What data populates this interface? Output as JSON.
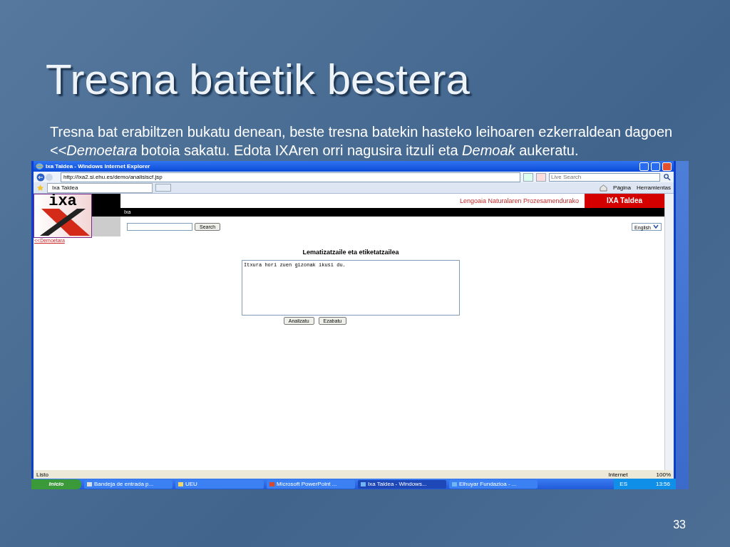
{
  "slide": {
    "title": "Tresna batetik bestera",
    "body": "Tresna bat erabiltzen bukatu denean, beste tresna batekin hasteko leihoaren ezkerraldean dagoen <<*Demoetara* botoia sakatu. Edota IXAren orri nagusira itzuli eta *Demoak* aukeratu.",
    "page_number": "33"
  },
  "browser": {
    "title": "Ixa Taldea - Windows Internet Explorer",
    "address": "http://ixa2.si.ehu.es/demo/analisiscf.jsp",
    "search_placeholder": "Live Search",
    "tab": "Ixa Taldea",
    "toolbar": [
      "Página",
      "Herramientas"
    ],
    "status": "Listo",
    "zone": "Internet",
    "zoom": "100%"
  },
  "page": {
    "logo": "ixa",
    "header": "Lengoaia Naturalaren Prozesamendurako",
    "brand": "IXA Taldea",
    "nav": "Ixa",
    "search_button": "Search",
    "language": "English",
    "back_link": "<<Demoetara",
    "heading": "Lematizatzaile eta etiketatzailea",
    "text": "Itxura hori zuen gizonak ikusi du.",
    "buttons": [
      "Analizatu",
      "Ezabatu"
    ]
  },
  "taskbar": {
    "start": "Inicio",
    "items": [
      {
        "label": "Bandeja de entrada p...",
        "kind": "mail",
        "selected": false
      },
      {
        "label": "UEU",
        "kind": "folder",
        "selected": false
      },
      {
        "label": "Microsoft PowerPoint ...",
        "kind": "slides",
        "selected": false
      },
      {
        "label": "Ixa Taldea - Windows...",
        "kind": "browser",
        "selected": true
      },
      {
        "label": "Elhuyar Fundazioa - ...",
        "kind": "browser",
        "selected": false
      }
    ],
    "language": "ES",
    "clock": "13:56"
  }
}
